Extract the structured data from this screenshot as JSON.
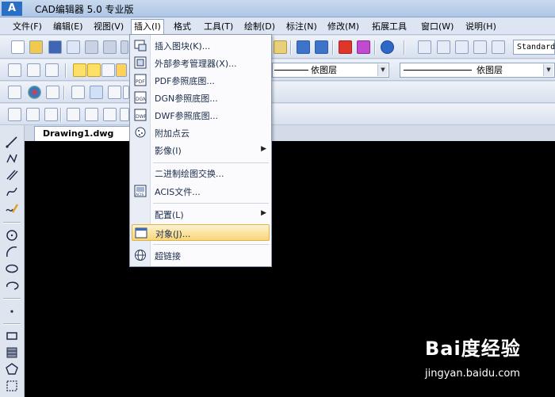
{
  "window": {
    "title": "CAD编辑器 5.0 专业版",
    "app_icon_text": "A"
  },
  "menubar": {
    "items": [
      {
        "label": "文件(F)"
      },
      {
        "label": "编辑(E)"
      },
      {
        "label": "视图(V)"
      },
      {
        "label": "插入(I)"
      },
      {
        "label": "格式"
      },
      {
        "label": "工具(T)"
      },
      {
        "label": "绘制(D)"
      },
      {
        "label": "标注(N)"
      },
      {
        "label": "修改(M)"
      },
      {
        "label": "拓展工具"
      },
      {
        "label": "窗口(W)"
      },
      {
        "label": "说明(H)"
      }
    ]
  },
  "toolbar": {
    "text_style": "Standard",
    "layer_linetype": "依图层",
    "layer_lineweight": "依图层"
  },
  "tabs": {
    "document": "Drawing1.dwg",
    "close_glyph": "×"
  },
  "insert_menu": {
    "items": [
      {
        "label": "插入图块(K)...",
        "icon": "insert-block-icon"
      },
      {
        "label": "外部参考管理器(X)...",
        "icon": "xref-manager-icon"
      },
      {
        "label": "PDF参照底图...",
        "icon": "pdf-underlay-icon"
      },
      {
        "label": "DGN参照底图...",
        "icon": "dgn-underlay-icon"
      },
      {
        "label": "DWF参照底图...",
        "icon": "dwf-underlay-icon"
      },
      {
        "label": "附加点云",
        "icon": "point-cloud-icon"
      },
      {
        "label": "影像(I)",
        "icon": ""
      },
      {
        "label": "二进制绘图交换...",
        "icon": ""
      },
      {
        "label": "ACIS文件...",
        "icon": "acis-file-icon"
      },
      {
        "label": "配置(L)",
        "icon": ""
      },
      {
        "label": "对象(J)...",
        "icon": "ole-object-icon"
      },
      {
        "label": "超链接",
        "icon": "hyperlink-icon"
      }
    ],
    "submenu_glyph": "▶"
  },
  "watermark": {
    "brand": "Bai度经验",
    "sub": "jingyan.baidu.com"
  }
}
